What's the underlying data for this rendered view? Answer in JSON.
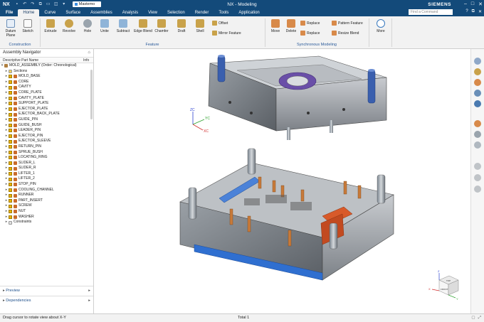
{
  "titlebar": {
    "app_logo": "NX",
    "file_dropdown": "Mastemo",
    "title": "NX - Modeling",
    "brand": "SIEMENS",
    "quick_access_icons": [
      "save-icon",
      "undo-icon",
      "redo-icon",
      "copy-icon",
      "paste-icon",
      "window-icon",
      "more-icon"
    ],
    "window_controls": [
      "–",
      "□",
      "✕"
    ]
  },
  "menu": {
    "tabs": [
      "File",
      "Home",
      "Curve",
      "Surface",
      "Assemblies",
      "Analysis",
      "View",
      "Selection",
      "Render",
      "Tools",
      "Application"
    ],
    "active_tab": "Home",
    "search_placeholder": "Find a Command"
  },
  "ribbon": {
    "construction": {
      "label": "Construction",
      "buttons": [
        "Datum Plane",
        "Sketch"
      ]
    },
    "feature": {
      "label": "Feature",
      "buttons": [
        "Extrude",
        "Revolve",
        "Hole",
        "Unite",
        "Subtract",
        "Edge Blend",
        "Chamfer",
        "Draft",
        "Shell"
      ],
      "small": [
        "Offset",
        "Mirror Feature"
      ]
    },
    "synchronous": {
      "label": "Synchronous Modeling",
      "buttons": [
        "Move",
        "Delete"
      ],
      "small": [
        "Replace",
        "Pattern Feature",
        "Replace",
        "Resize Blend"
      ]
    },
    "more": "More"
  },
  "navigator": {
    "title": "Assembly Navigator",
    "col_name": "Descriptive Part Name",
    "col_info": "Info",
    "root": "MOLD_ASSEMBLY (Order: Chronological)",
    "sections": "Sections",
    "parts": [
      "MOLD_BASE",
      "CORE",
      "CAVITY",
      "CORE_PLATE",
      "CAVITY_PLATE",
      "SUPPORT_PLATE",
      "EJECTOR_PLATE",
      "EJECTOR_BACK_PLATE",
      "GUIDE_PIN",
      "GUIDE_BUSH",
      "LEADER_PIN",
      "EJECTOR_PIN",
      "EJECTOR_SLEEVE",
      "RETURN_PIN",
      "SPRUE_BUSH",
      "LOCATING_RING",
      "SLIDER_L",
      "SLIDER_R",
      "LIFTER_1",
      "LIFTER_2",
      "STOP_PIN",
      "COOLING_CHANNEL",
      "RUNNER",
      "PART_INSERT",
      "SCREW",
      "NUT",
      "WASHER"
    ],
    "constraints": "Constraints",
    "panels": [
      "Preview",
      "Dependencies"
    ]
  },
  "viewport": {
    "triad": {
      "x": "XC",
      "y": "YC",
      "z": "ZC"
    },
    "viewcube": {
      "x": "X",
      "y": "Y",
      "z": "Z",
      "top": "TOP",
      "front": "FRONT"
    }
  },
  "statusbar": {
    "message": "Drag cursor to rotate view about X-Y",
    "selection_total": "Total 1"
  },
  "colors": {
    "title_bg": "#134a7a",
    "ribbon_bg": "#f2f2f2",
    "accent_blue": "#2f6fd0",
    "accent_orange": "#d85a2a",
    "accent_purple": "#6a4fa8"
  }
}
